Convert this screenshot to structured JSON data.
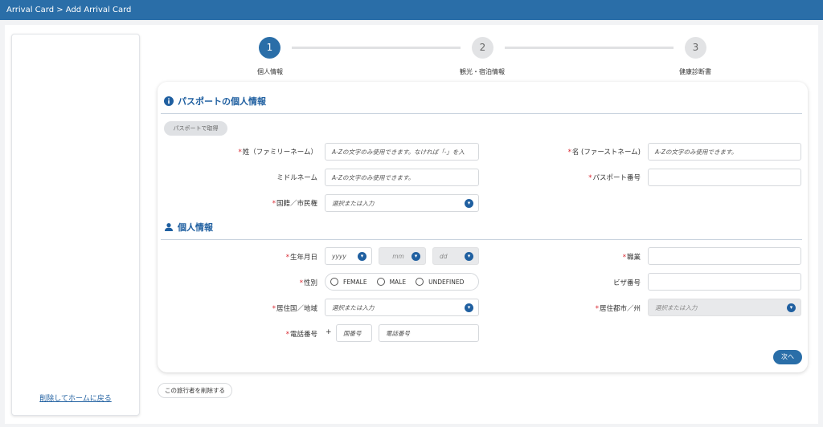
{
  "breadcrumb": "Arrival Card > Add Arrival Card",
  "sidebar": {
    "back_link": "削除してホームに戻る"
  },
  "steps": [
    {
      "number": "1",
      "label": "個人情報"
    },
    {
      "number": "2",
      "label": "観光・宿泊情報"
    },
    {
      "number": "3",
      "label": "健康診断書"
    }
  ],
  "passport_section": {
    "title": "パスポートの個人情報",
    "fetch_button": "パスポートで取得",
    "surname_label": "姓（ファミリーネーム）",
    "surname_placeholder": "A-Zの文字のみ使用できます。なければ「-」を入",
    "given_name_label": "名 (ファーストネーム)",
    "given_name_placeholder": "A-Zの文字のみ使用できます。",
    "middle_name_label": "ミドルネーム",
    "middle_name_placeholder": "A-Zの文字のみ使用できます。",
    "passport_number_label": "パスポート番号",
    "passport_number_value": "",
    "nationality_label": "国籍／市民権",
    "nationality_placeholder": "選択または入力"
  },
  "personal_section": {
    "title": "個人情報",
    "dob_label": "生年月日",
    "dob_year": "yyyy",
    "dob_month": "mm",
    "dob_day": "dd",
    "occupation_label": "職業",
    "occupation_value": "",
    "gender_label": "性別",
    "gender_options": [
      "FEMALE",
      "MALE",
      "UNDEFINED"
    ],
    "visa_label": "ビザ番号",
    "visa_value": "",
    "country_label": "居住国／地域",
    "country_placeholder": "選択または入力",
    "city_label": "居住都市／州",
    "city_placeholder": "選択または入力",
    "phone_label": "電話番号",
    "phone_plus": "+",
    "phone_code_placeholder": "国番号",
    "phone_number_placeholder": "電話番号",
    "next_button": "次へ"
  },
  "delete_traveler_button": "この旅行者を削除する",
  "colors": {
    "header": "#2a6ea8",
    "accent": "#1f5fa0",
    "required": "#d9262f"
  },
  "icons": {
    "passport": "info-circle-icon",
    "personal": "person-icon",
    "dropdown": "chevron-down-icon",
    "required": "asterisk"
  }
}
